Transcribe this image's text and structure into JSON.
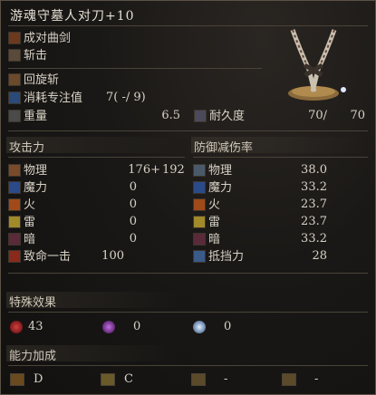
{
  "header": {
    "title": "游魂守墓人对刀+10"
  },
  "weapon": {
    "type": "成对曲剑",
    "attack_type": "斩击",
    "skill": "回旋斩",
    "fp_label": "消耗专注值",
    "fp_value": "7(  -/ 9)",
    "weight_label": "重量",
    "weight_value": "6.5",
    "durability_label": "耐久度",
    "durability_value": "70/",
    "durability_max": "70"
  },
  "attack": {
    "title": "攻击力",
    "rows": [
      {
        "label": "物理",
        "value": "176+",
        "extra": "192",
        "icon": "physical-icon"
      },
      {
        "label": "魔力",
        "value": "0",
        "icon": "magic-icon"
      },
      {
        "label": "火",
        "value": "0",
        "icon": "fire-icon"
      },
      {
        "label": "雷",
        "value": "0",
        "icon": "lightning-icon"
      },
      {
        "label": "暗",
        "value": "0",
        "icon": "dark-icon"
      },
      {
        "label": "致命一击",
        "value": "100",
        "icon": "critical-icon"
      }
    ]
  },
  "defense": {
    "title": "防御减伤率",
    "rows": [
      {
        "label": "物理",
        "value": "38.0",
        "icon": "physical-defense-icon"
      },
      {
        "label": "魔力",
        "value": "33.2",
        "icon": "magic-defense-icon"
      },
      {
        "label": "火",
        "value": "23.7",
        "icon": "fire-defense-icon"
      },
      {
        "label": "雷",
        "value": "23.7",
        "icon": "lightning-defense-icon"
      },
      {
        "label": "暗",
        "value": "33.2",
        "icon": "dark-defense-icon"
      },
      {
        "label": "抵挡力",
        "value": "28",
        "icon": "stability-icon"
      }
    ]
  },
  "special": {
    "title": "特殊效果",
    "effects": [
      {
        "value": "43",
        "icon": "bleed-icon",
        "color": "#a02020"
      },
      {
        "value": "0",
        "icon": "poison-icon",
        "color": "#8a3aa0"
      },
      {
        "value": "0",
        "icon": "frost-icon",
        "color": "#7aa8e0"
      }
    ]
  },
  "scaling": {
    "title": "能力加成",
    "items": [
      {
        "grade": "D",
        "icon": "strength-icon"
      },
      {
        "grade": "C",
        "icon": "dexterity-icon"
      },
      {
        "grade": "-",
        "icon": "intelligence-icon"
      },
      {
        "grade": "-",
        "icon": "faith-icon"
      }
    ]
  }
}
